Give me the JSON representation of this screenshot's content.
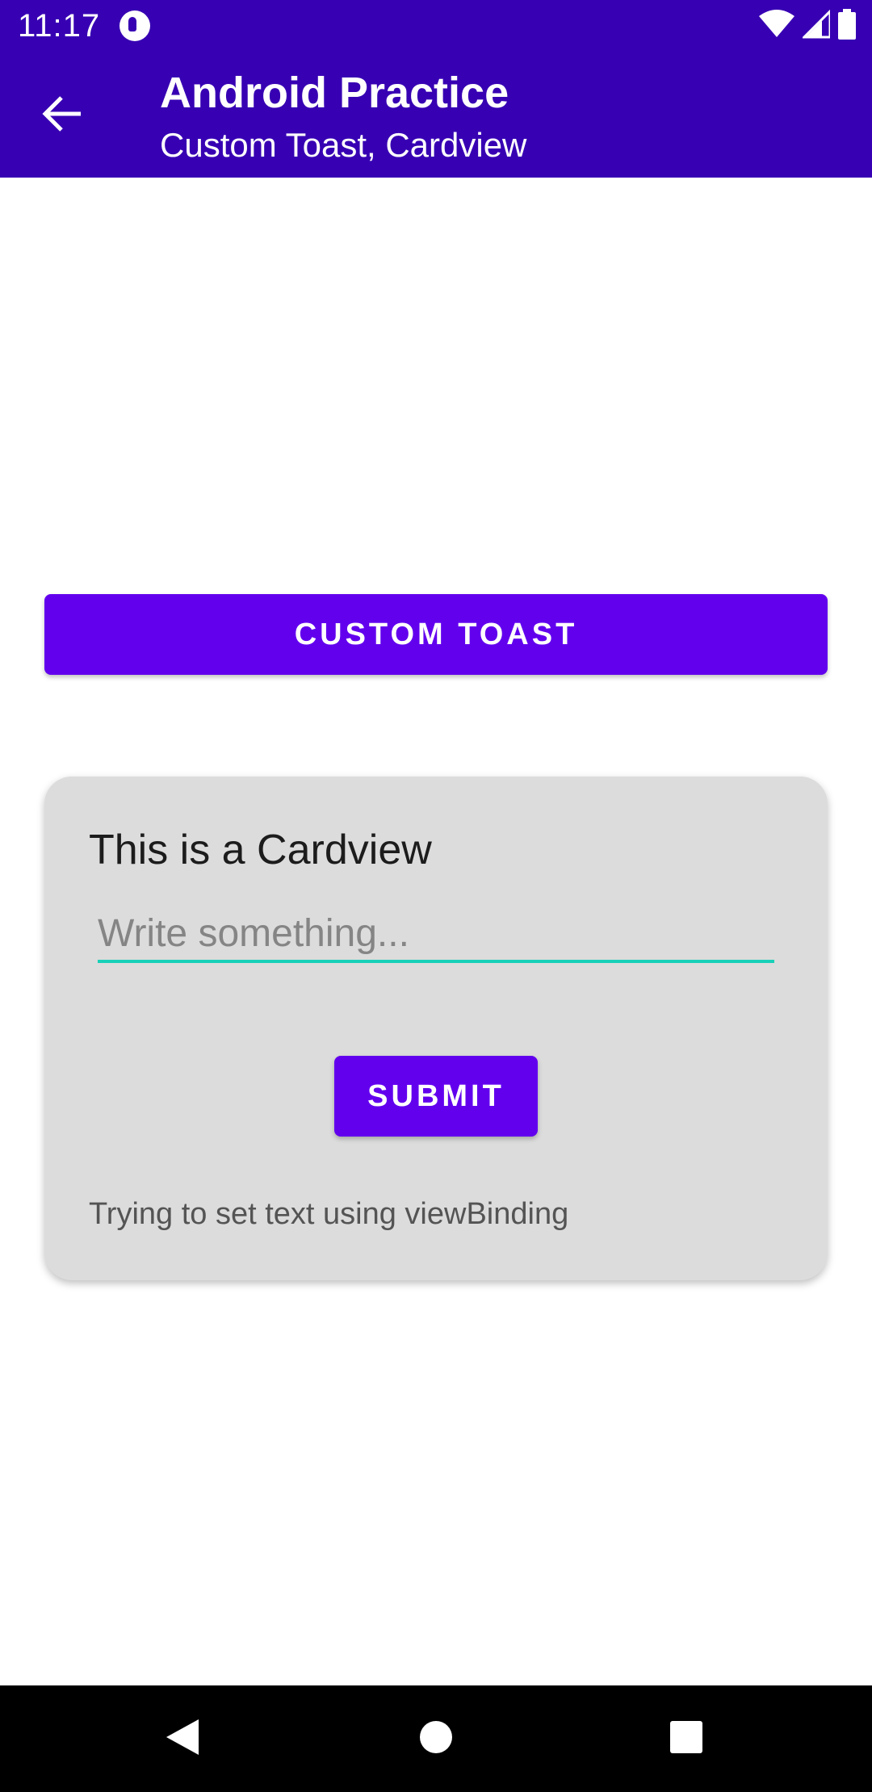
{
  "status_bar": {
    "time": "11:17",
    "icons": [
      "app-notification-icon",
      "wifi-icon",
      "cell-signal-icon",
      "battery-icon"
    ]
  },
  "app_bar": {
    "title": "Android Practice",
    "subtitle": "Custom Toast, Cardview",
    "back_icon": "arrow-back-icon",
    "background": "#3700b3"
  },
  "main": {
    "custom_toast_label": "CUSTOM TOAST",
    "card": {
      "title": "This is a Cardview",
      "input_placeholder": "Write something...",
      "input_value": "",
      "submit_label": "SUBMIT",
      "note": "Trying to set text using viewBinding"
    }
  },
  "nav_bar": {
    "items": [
      "back-triangle-icon",
      "home-circle-icon",
      "recents-square-icon"
    ]
  },
  "colors": {
    "primary": "#6200ee",
    "primary_dark": "#3700b3",
    "accent": "#18d0b8",
    "card_bg": "#dcdcdc"
  }
}
